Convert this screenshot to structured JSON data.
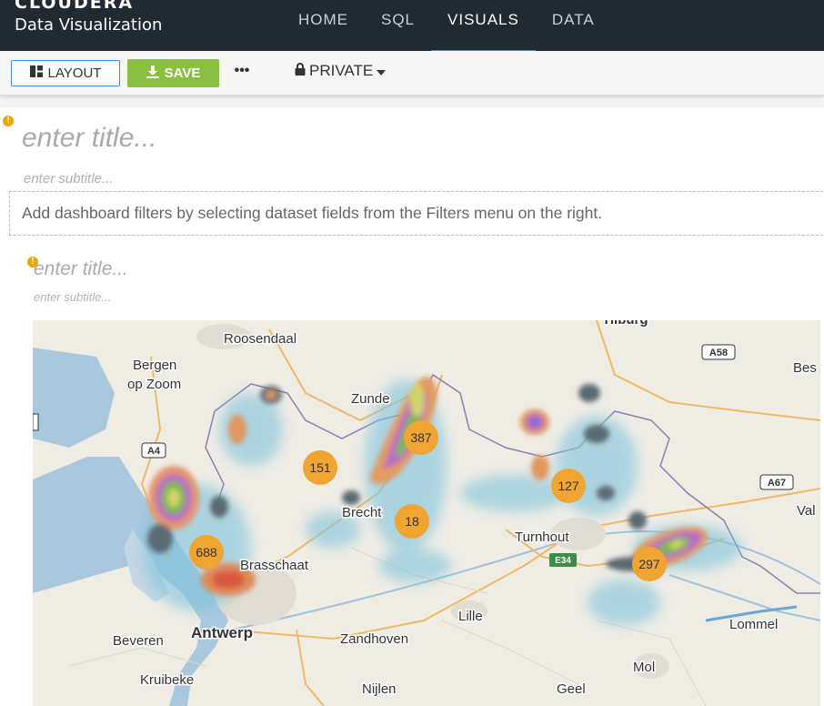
{
  "header": {
    "logo_text": "CLOUDERA",
    "app_name": "Data Visualization",
    "nav": [
      {
        "label": "HOME",
        "active": false
      },
      {
        "label": "SQL",
        "active": false
      },
      {
        "label": "VISUALS",
        "active": true
      },
      {
        "label": "DATA",
        "active": false
      }
    ]
  },
  "toolbar": {
    "layout_label": "LAYOUT",
    "save_label": "SAVE",
    "more_label": "•••",
    "privacy_label": "PRIVATE"
  },
  "dashboard": {
    "title_placeholder": "enter title...",
    "subtitle_placeholder": "enter subtitle...",
    "filter_hint": "Add dashboard filters by selecting dataset fields from the Filters menu on the right."
  },
  "visual": {
    "title_placeholder": "enter title...",
    "subtitle_placeholder": "enter subtitle...",
    "clusters": [
      "387",
      "151",
      "18",
      "688",
      "127",
      "297"
    ],
    "places": [
      "Roosendaal",
      "Bergen",
      "op Zoom",
      "Zunde",
      "Brecht",
      "Brasschaat",
      "Antwerp",
      "Zandhoven",
      "Turnhout",
      "Lille",
      "Beveren",
      "Kruibeke",
      "Nijlen",
      "Geel",
      "Mol",
      "Lommel",
      "Bes",
      "Val",
      "Tilburg"
    ],
    "road_labels": [
      "A58",
      "A4",
      "A67",
      "E34"
    ],
    "colors": {
      "accent_blue": "#3b8fd6",
      "save_green": "#8bbf43",
      "cluster_orange": "#f0a431",
      "header_bg": "#1f2a33"
    }
  }
}
